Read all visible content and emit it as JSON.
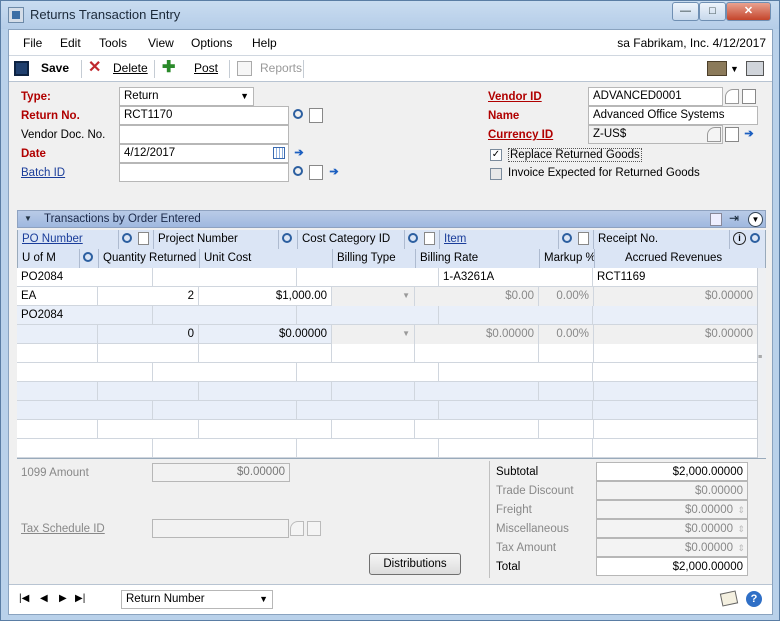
{
  "window": {
    "title": "Returns Transaction Entry",
    "min": "—",
    "max": "□",
    "close": "✕"
  },
  "menu": {
    "items": [
      "File",
      "Edit",
      "Tools",
      "View",
      "Options",
      "Help"
    ],
    "right": "sa  Fabrikam, Inc.  4/12/2017"
  },
  "toolbar": {
    "save": "Save",
    "delete": "Delete",
    "post": "Post",
    "reports": "Reports"
  },
  "form": {
    "type_label": "Type:",
    "type_value": "Return",
    "return_no_label": "Return No.",
    "return_no": "RCT1170",
    "vendor_doc_label": "Vendor Doc. No.",
    "vendor_doc": "",
    "date_label": "Date",
    "date": "4/12/2017",
    "batch_label": "Batch ID",
    "batch": "",
    "vendor_id_label": "Vendor ID",
    "vendor_id": "ADVANCED0001",
    "name_label": "Name",
    "name": "Advanced Office Systems",
    "currency_label": "Currency ID",
    "currency": "Z-US$",
    "replace_label": "Replace Returned Goods",
    "replace_checked": "✓",
    "invoice_label": "Invoice Expected for Returned Goods"
  },
  "grid": {
    "title": "Transactions by Order Entered",
    "h1": [
      "PO Number",
      "Project Number",
      "Cost Category ID",
      "Item",
      "Receipt No."
    ],
    "h2": [
      "U of M",
      "Quantity Returned",
      "Unit Cost",
      "Billing Type",
      "Billing Rate",
      "Markup %",
      "Accrued Revenues"
    ],
    "rows": [
      {
        "po": "PO2084",
        "item": "1-A3261A",
        "receipt": "RCT1169"
      },
      {
        "uom": "EA",
        "qty": "2",
        "cost": "$1,000.00",
        "rate": "$0.00",
        "markup": "0.00%",
        "accrued": "$0.00000"
      },
      {
        "po": "PO2084",
        "item": "",
        "receipt": ""
      },
      {
        "uom": "",
        "qty": "0",
        "cost": "$0.00000",
        "rate": "$0.00000",
        "markup": "0.00%",
        "accrued": "$0.00000"
      }
    ]
  },
  "bottom": {
    "amount1099_label": "1099 Amount",
    "amount1099": "$0.00000",
    "taxsched_label": "Tax Schedule ID",
    "distributions": "Distributions",
    "subtotal_label": "Subtotal",
    "subtotal": "$2,000.00000",
    "trade_label": "Trade Discount",
    "trade": "$0.00000",
    "freight_label": "Freight",
    "freight": "$0.00000",
    "misc_label": "Miscellaneous",
    "misc": "$0.00000",
    "tax_label": "Tax Amount",
    "tax": "$0.00000",
    "total_label": "Total",
    "total": "$2,000.00000"
  },
  "status": {
    "sort": "Return Number"
  }
}
